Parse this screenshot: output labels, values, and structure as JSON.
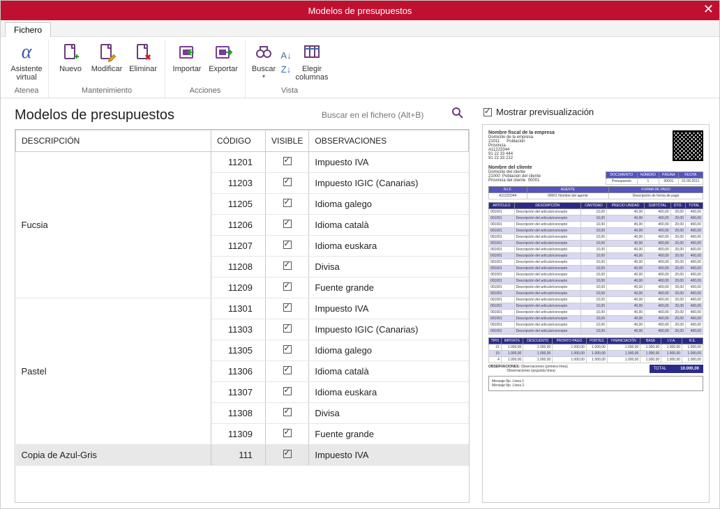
{
  "window": {
    "title": "Modelos de presupuestos"
  },
  "tabs": {
    "file": "Fichero"
  },
  "ribbon": {
    "groups": [
      {
        "label": "Atenea",
        "buttons": [
          {
            "name": "assistant",
            "label": "Asistente\nvirtual"
          }
        ]
      },
      {
        "label": "Mantenimiento",
        "buttons": [
          {
            "name": "new",
            "label": "Nuevo"
          },
          {
            "name": "edit",
            "label": "Modificar"
          },
          {
            "name": "delete",
            "label": "Eliminar"
          }
        ]
      },
      {
        "label": "Acciones",
        "buttons": [
          {
            "name": "import",
            "label": "Importar"
          },
          {
            "name": "export",
            "label": "Exportar"
          }
        ]
      },
      {
        "label": "Vista",
        "buttons_search": {
          "label": "Buscar"
        },
        "sort_asc": "A→Z",
        "sort_desc": "Z→A",
        "columns": {
          "label": "Elegir\ncolumnas"
        }
      }
    ]
  },
  "page_heading": "Modelos de presupuestos",
  "search": {
    "placeholder": "Buscar en el fichero (Alt+B)"
  },
  "columns": {
    "desc": "DESCRIPCIÓN",
    "code": "CÓDIGO",
    "visible": "VISIBLE",
    "obs": "OBSERVACIONES"
  },
  "rows": [
    {
      "group": "Fucsia",
      "code": "11201",
      "visible": true,
      "obs": "Impuesto IVA"
    },
    {
      "group": "",
      "code": "11203",
      "visible": true,
      "obs": "Impuesto IGIC (Canarias)"
    },
    {
      "group": "",
      "code": "11205",
      "visible": true,
      "obs": "Idioma galego"
    },
    {
      "group": "",
      "code": "11206",
      "visible": true,
      "obs": "Idioma català"
    },
    {
      "group": "",
      "code": "11207",
      "visible": true,
      "obs": "Idioma euskara"
    },
    {
      "group": "",
      "code": "11208",
      "visible": true,
      "obs": "Divisa"
    },
    {
      "group": "",
      "code": "11209",
      "visible": true,
      "obs": "Fuente grande"
    },
    {
      "group": "Pastel",
      "code": "11301",
      "visible": true,
      "obs": "Impuesto IVA"
    },
    {
      "group": "",
      "code": "11303",
      "visible": true,
      "obs": "Impuesto IGIC (Canarias)"
    },
    {
      "group": "",
      "code": "11305",
      "visible": true,
      "obs": "Idioma galego"
    },
    {
      "group": "",
      "code": "11306",
      "visible": true,
      "obs": "Idioma català"
    },
    {
      "group": "",
      "code": "11307",
      "visible": true,
      "obs": "Idioma euskara"
    },
    {
      "group": "",
      "code": "11308",
      "visible": true,
      "obs": "Divisa"
    },
    {
      "group": "",
      "code": "11309",
      "visible": true,
      "obs": "Fuente grande"
    },
    {
      "group": "Copia de Azul-Gris",
      "code": "111",
      "visible": true,
      "obs": "Impuesto IVA",
      "selected": true
    }
  ],
  "preview": {
    "checkbox_label": "Mostrar previsualización",
    "checked": true,
    "company": {
      "title": "Nombre fiscal de la empresa",
      "addr": "Domicilio de la empresa",
      "cp": "21011",
      "pob": "Población",
      "prov": "Provincia",
      "nif": "A11223344",
      "tel": "91 22 33 444",
      "fax": "91 22 33 222"
    },
    "client": {
      "title": "Nombre del cliente",
      "addr": "Domicilio del cliente",
      "cp": "21000",
      "pob": "Población del cliente",
      "prov": "Provincia del cliente",
      "code": "00001"
    },
    "meta_headers": [
      "DOCUMENTO",
      "NÚMERO",
      "PÁGINA",
      "FECHA"
    ],
    "meta_values": [
      "Presupuesto",
      "1",
      "00001",
      "01-06-2011"
    ],
    "agent_headers": [
      "N.I.F.",
      "AGENTE",
      "FORMA DE PAGO"
    ],
    "agent_values": [
      "A11223344",
      "00001   Nombre del agente",
      "Descripción de forma de pago"
    ],
    "line_headers": [
      "ARTÍCULO",
      "DESCRIPCIÓN",
      "CANTIDAD",
      "PRECIO UNIDAD",
      "SUBTOTAL",
      "DTO.",
      "TOTAL"
    ],
    "line_sample": [
      "001001",
      "Descripción del artículo/concepto",
      "10,00",
      "40,00",
      "400,00",
      "20,00",
      "400,00"
    ],
    "line_count": 20,
    "totals_headers": [
      "TIPO",
      "IMPORTE",
      "DESCUENTO",
      "PRONTO PAGO",
      "PORTES",
      "FINANCIACIÓN",
      "BASE",
      "I.V.A.",
      "R.E."
    ],
    "totals_rows": [
      [
        "21",
        "1.000,00",
        "1.000,00",
        "1.000,00",
        "1.000,00",
        "1.000,00",
        "1.000,00",
        "1.000,00",
        "1.000,00"
      ],
      [
        "10",
        "1.000,00",
        "1.000,00",
        "1.000,00",
        "1.000,00",
        "1.000,00",
        "1.000,00",
        "1.000,00",
        "1.000,00"
      ],
      [
        "4",
        "1.000,00",
        "1.000,00",
        "1.000,00",
        "1.000,00",
        "1.000,00",
        "1.000,00",
        "1.000,00",
        "1.000,00"
      ]
    ],
    "obs_label": "OBSERVACIONES:",
    "obs_lines": [
      "Observaciones (primera línea)",
      "Observaciones (segunda línea)"
    ],
    "total_label": "TOTAL",
    "total_value": "10.000,00",
    "footer_lines": [
      "Mensaje fijo. Línea 1",
      "Mensaje fijo. Línea 2"
    ]
  }
}
